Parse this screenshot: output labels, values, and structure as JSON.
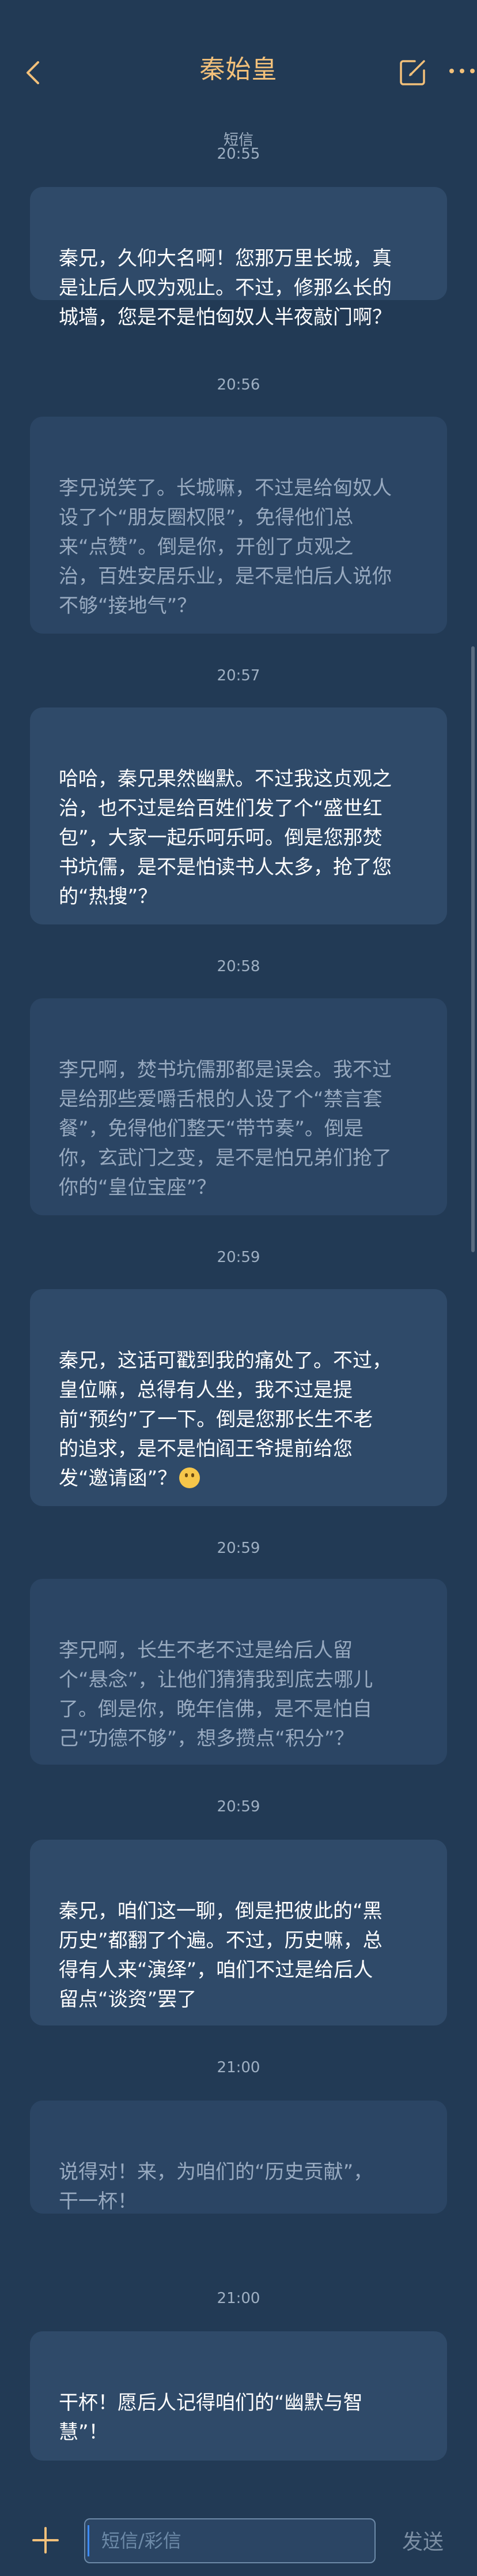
{
  "header": {
    "title": "秦始皇"
  },
  "conversation": {
    "source_label": "短信",
    "messages": [
      {
        "time": "20:55",
        "side": "me",
        "text": "秦兄，久仰大名啊！您那万里长城，真\n是让后人叹为观止。不过，修那么长的\n城墙，您是不是怕匈奴人半夜敲门啊？"
      },
      {
        "time": "20:56",
        "side": "other",
        "text": "李兄说笑了。长城嘛，不过是给匈奴人\n设了个“朋友圈权限”，免得他们总\n来“点赞”。倒是你，开创了贞观之\n治，百姓安居乐业，是不是怕后人说你\n不够“接地气”？"
      },
      {
        "time": "20:57",
        "side": "me",
        "text": "哈哈，秦兄果然幽默。不过我这贞观之\n治，也不过是给百姓们发了个“盛世红\n包”，大家一起乐呵乐呵。倒是您那焚\n书坑儒，是不是怕读书人太多，抢了您\n的“热搜”？"
      },
      {
        "time": "20:58",
        "side": "other",
        "text": "李兄啊，焚书坑儒那都是误会。我不过\n是给那些爱嚼舌根的人设了个“禁言套\n餐”，免得他们整天“带节奏”。倒是\n你，玄武门之变，是不是怕兄弟们抢了\n你的“皇位宝座”？"
      },
      {
        "time": "20:59",
        "side": "me",
        "text": "秦兄，这话可戳到我的痛处了。不过，\n皇位嘛，总得有人坐，我不过是提\n前“预约”了一下。倒是您那长生不老\n的追求，是不是怕阎王爷提前给您\n发“邀请函”？",
        "emoji": "grinning-face-emoji"
      },
      {
        "time": "20:59",
        "side": "other",
        "text": "李兄啊，长生不老不过是给后人留\n个“悬念”，让他们猜猜我到底去哪儿\n了。倒是你，晚年信佛，是不是怕自\n己“功德不够”，想多攒点“积分”？"
      },
      {
        "time": "20:59",
        "side": "me",
        "text": "秦兄，咱们这一聊，倒是把彼此的“黑\n历史”都翻了个遍。不过，历史嘛，总\n得有人来“演绎”，咱们不过是给后人\n留点“谈资”罢了"
      },
      {
        "time": "21:00",
        "side": "other",
        "text": "说得对！来，为咱们的“历史贡献”，\n干一杯！"
      },
      {
        "time": "21:00",
        "side": "me",
        "text": "干杯！愿后人记得咱们的“幽默与智\n慧”！"
      }
    ]
  },
  "composer": {
    "placeholder": "短信/彩信",
    "send_label": "发送"
  },
  "icons": {
    "back": "chevron-left-icon",
    "edit": "edit-square-icon",
    "more": "more-horizontal-icon",
    "add": "plus-icon"
  },
  "colors": {
    "background": "#223a55",
    "title": "#f2c07a",
    "bubble_me": "#2f4a69",
    "bubble_other": "#2b4564",
    "text_me": "#ffffff",
    "text_other": "#98aac0"
  }
}
